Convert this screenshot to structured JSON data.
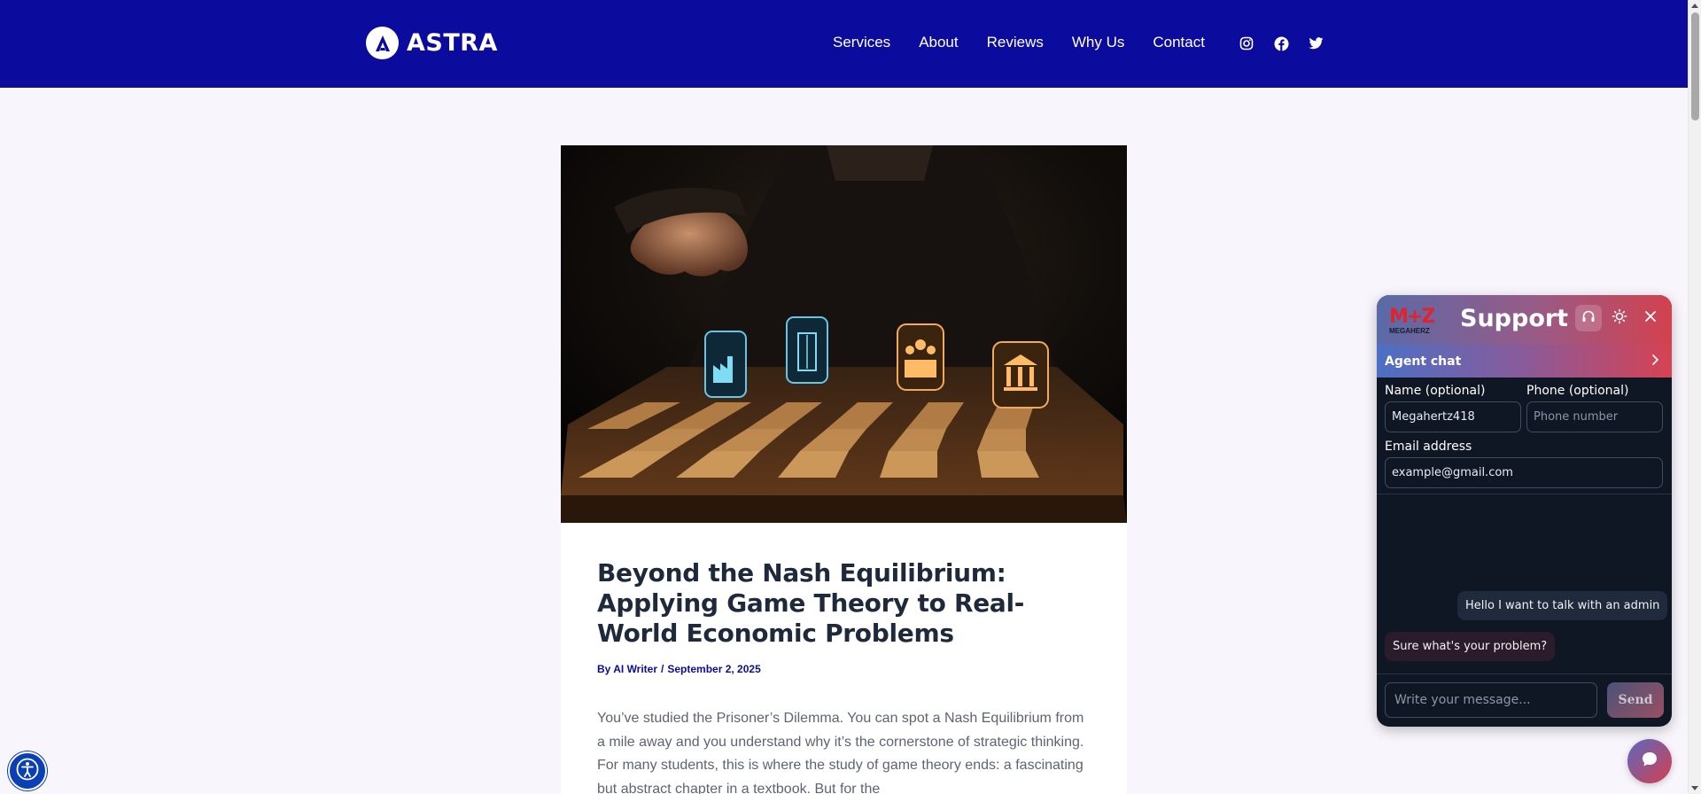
{
  "header": {
    "logo_text": "ASTRA",
    "nav": [
      "Services",
      "About",
      "Reviews",
      "Why Us",
      "Contact"
    ],
    "social_icons": [
      "instagram-icon",
      "facebook-icon",
      "twitter-icon"
    ]
  },
  "post": {
    "title": "Beyond the Nash Equilibrium: Applying Game Theory to Real-World Economic Problems",
    "author": "By AI Writer",
    "separator": "/",
    "date": "September 2, 2025",
    "excerpt": "You’ve studied the Prisoner’s Dilemma. You can spot a Nash Equilibrium from a mile away and you understand why it’s the cornerstone of strategic thinking. For many students, this is where the study of game theory ends: a fascinating but abstract chapter in a textbook. But for the"
  },
  "chat": {
    "brand": "M+Z",
    "brand_sub": "MEGAHERZ",
    "title": "Support",
    "agent_chat_label": "Agent chat",
    "name_label": "Name (optional)",
    "name_value": "Megahertz418",
    "phone_label": "Phone (optional)",
    "phone_placeholder": "Phone number",
    "email_label": "Email address",
    "email_value": "example@gmail.com",
    "messages": [
      {
        "from": "user",
        "text": "Hello I want to talk with an admin"
      },
      {
        "from": "agent",
        "text": "Sure what's your problem?"
      }
    ],
    "input_placeholder": "Write your message...",
    "send_label": "Send"
  },
  "colors": {
    "header_bg": "#0b0b9e",
    "page_bg": "#f8f5fc",
    "chat_bg": "#0f1624",
    "accent_red": "#d3414f"
  }
}
